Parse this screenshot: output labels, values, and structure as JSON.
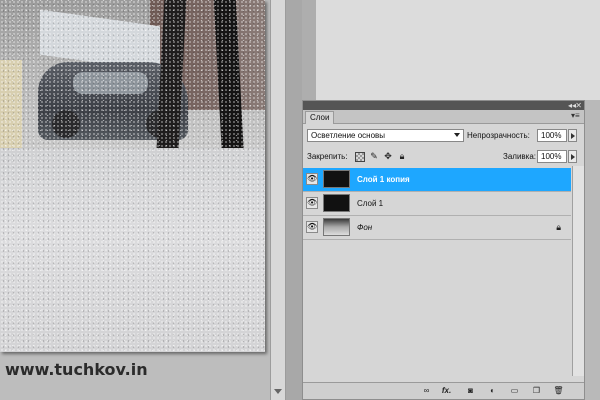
{
  "watermark": "www.tuchkov.in",
  "layers_panel": {
    "tab_label": "Слои",
    "blend_mode": "Осветление основы",
    "opacity_label": "Непрозрачность:",
    "opacity_value": "100%",
    "lock_label": "Закрепить:",
    "fill_label": "Заливка:",
    "fill_value": "100%",
    "layers": [
      {
        "name": "Слой 1 копия",
        "selected": true,
        "visible": true
      },
      {
        "name": "Слой 1",
        "selected": false,
        "visible": true
      },
      {
        "name": "Фон",
        "selected": false,
        "visible": true,
        "locked": true
      }
    ],
    "selection_color": "#1ea7ff"
  },
  "icons": {
    "visibility": "eye-icon",
    "lock": "lock-icon",
    "link": "link-layers-icon",
    "fx": "fx-icon",
    "mask": "layer-mask-icon",
    "adjustment": "adjustment-layer-icon",
    "group": "folder-icon",
    "new_layer": "new-layer-icon",
    "trash": "trash-icon"
  },
  "footer_fx_label": "fx."
}
